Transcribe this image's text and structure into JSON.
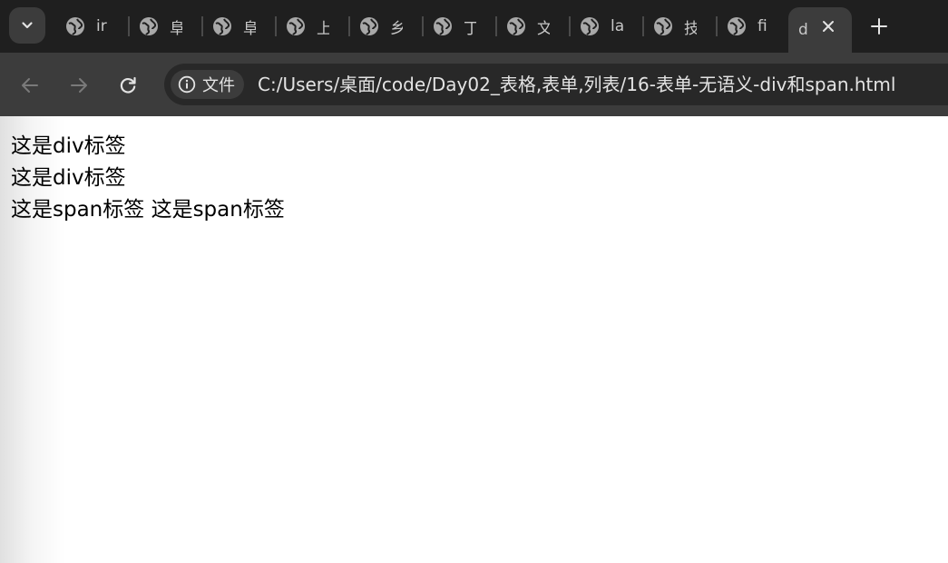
{
  "browser": {
    "tabs": [
      {
        "title": "ir"
      },
      {
        "title": "阜"
      },
      {
        "title": "阜"
      },
      {
        "title": "上"
      },
      {
        "title": "乡"
      },
      {
        "title": "丁"
      },
      {
        "title": "文"
      },
      {
        "title": "la"
      },
      {
        "title": "技"
      },
      {
        "title": "fi"
      },
      {
        "title": "d",
        "active": true
      }
    ],
    "address_bar": {
      "chip_label": "文件",
      "url": "C:/Users/桌面/code/Day02_表格,表单,列表/16-表单-无语义-div和span.html"
    },
    "icons": {
      "tab_search": "chevron-down-icon",
      "tab_favicon": "globe-icon",
      "close": "close-icon",
      "new_tab": "plus-icon",
      "back": "arrow-left-icon",
      "forward": "arrow-right-icon",
      "reload": "reload-icon",
      "site_info": "info-icon"
    }
  },
  "page": {
    "lines": [
      "这是div标签",
      "这是div标签",
      "这是span标签 这是span标签"
    ]
  }
}
